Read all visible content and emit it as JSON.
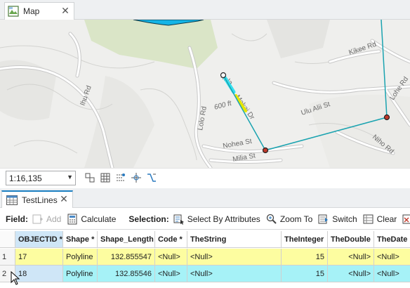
{
  "map_view": {
    "tab_label": "Map",
    "scale": "1:16,135",
    "street_labels": [
      "Kikee Rd",
      "Lohe Rd",
      "Ihu Rd",
      "Makai Dr",
      "Ulu Alii St",
      "600 ft",
      "Lolo Rd",
      "Nohea St",
      "Milia St",
      "Niho Rd",
      "kela"
    ],
    "colors": {
      "cyan_line": "#1aa3b0",
      "yellow_segment": "#e6e600",
      "highlight": "#33e0f0",
      "polygon": "#14b4e6"
    }
  },
  "table_view": {
    "tab_label": "TestLines",
    "toolbar": {
      "field_label": "Field:",
      "add_label": "Add",
      "calculate_label": "Calculate",
      "selection_label": "Selection:",
      "select_by_attributes_label": "Select By Attributes",
      "zoom_to_label": "Zoom To",
      "switch_label": "Switch",
      "clear_label": "Clear"
    },
    "columns": [
      "OBJECTID *",
      "Shape *",
      "Shape_Length",
      "Code *",
      "TheString",
      "TheInteger",
      "TheDouble",
      "TheDate"
    ],
    "rows": [
      {
        "row_number": "1",
        "OBJECTID": "17",
        "Shape": "Polyline",
        "Shape_Length": "132.855547",
        "Code": "<Null>",
        "TheString": "<Null>",
        "TheInteger": "15",
        "TheDouble": "<Null>",
        "TheDate": "<Null>",
        "row_color": "#fdfda0"
      },
      {
        "row_number": "2",
        "OBJECTID": "18",
        "Shape": "Polyline",
        "Shape_Length": "132.85546",
        "Code": "<Null>",
        "TheString": "<Null>",
        "TheInteger": "15",
        "TheDouble": "<Null>",
        "TheDate": "<Null>",
        "row_color": "#a6f2f7"
      }
    ]
  }
}
